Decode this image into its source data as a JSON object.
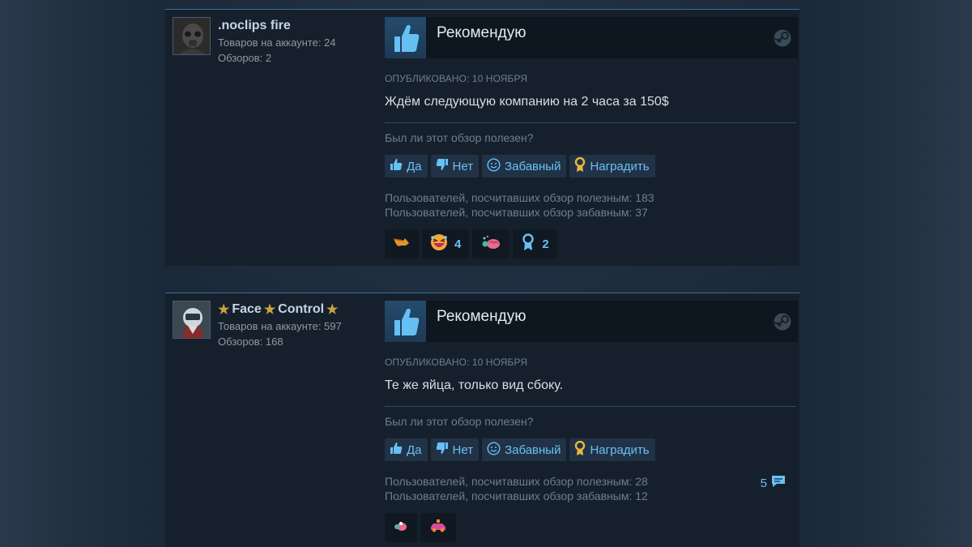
{
  "reviews": [
    {
      "author": {
        "name": ".noclips fire",
        "products_label": "Товаров на аккаунте: 24",
        "reviews_label": "Обзоров: 2"
      },
      "verdict": "Рекомендую",
      "posted": "ОПУБЛИКОВАНО: 10 НОЯБРЯ",
      "text": "Ждём следующую компанию на 2 часа за 150$",
      "helpful_question": "Был ли этот обзор полезен?",
      "buttons": {
        "yes": "Да",
        "no": "Нет",
        "funny": "Забавный",
        "award": "Наградить"
      },
      "helpful_count": "Пользователей, посчитавших обзор полезным: 183",
      "funny_count": "Пользователей, посчитавших обзор забавным: 37",
      "reactions": [
        {
          "icon": "pointing-hand-icon",
          "count": ""
        },
        {
          "icon": "laughing-face-icon",
          "count": "4"
        },
        {
          "icon": "brain-icon",
          "count": ""
        },
        {
          "icon": "ribbon-award-icon",
          "count": "2"
        }
      ]
    },
    {
      "author": {
        "name": "Face",
        "name_part2": "Control",
        "products_label": "Товаров на аккаунте: 597",
        "reviews_label": "Обзоров: 168"
      },
      "verdict": "Рекомендую",
      "posted": "ОПУБЛИКОВАНО: 10 НОЯБРЯ",
      "text": "Те же яйца, только вид сбоку.",
      "helpful_question": "Был ли этот обзор полезен?",
      "buttons": {
        "yes": "Да",
        "no": "Нет",
        "funny": "Забавный",
        "award": "Наградить"
      },
      "helpful_count": "Пользователей, посчитавших обзор полезным: 28",
      "funny_count": "Пользователей, посчитавших обзор забавным: 12",
      "comments": "5",
      "reactions": [
        {
          "icon": "brain-icon",
          "count": ""
        },
        {
          "icon": "car-icon",
          "count": ""
        }
      ]
    }
  ],
  "colors": {
    "link": "#67c1f5",
    "background": "#1b2838",
    "panel": "#16202d",
    "gold": "#c9a43a"
  }
}
